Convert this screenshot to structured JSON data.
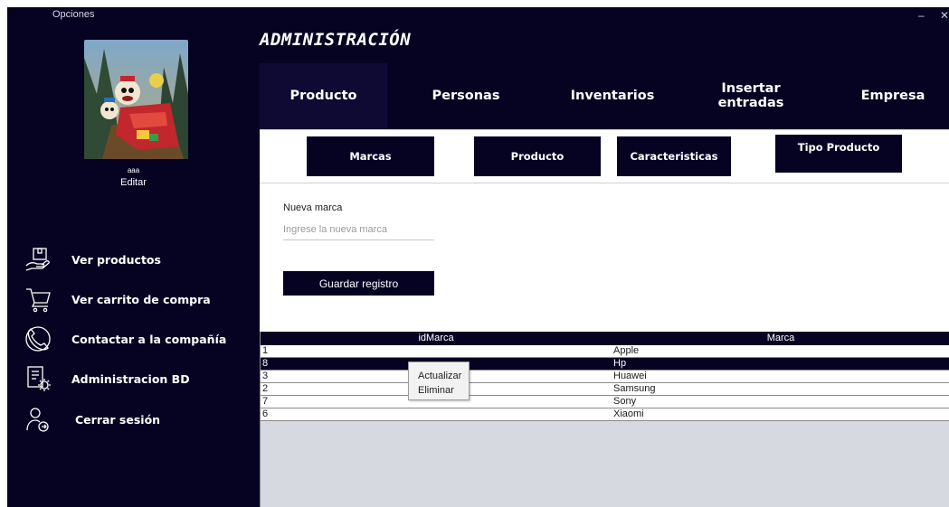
{
  "window": {
    "menu_label": "Opciones",
    "minimize_label": "–",
    "close_label": "✕"
  },
  "user": {
    "name": "aaa",
    "edit_label": "Editar"
  },
  "sidebar": {
    "items": [
      {
        "label": "Ver productos",
        "icon": "box-hand-icon"
      },
      {
        "label": "Ver carrito de compra",
        "icon": "shopping-cart-icon"
      },
      {
        "label": "Contactar a la compañía",
        "icon": "phone-icon"
      },
      {
        "label": "Administracion BD",
        "icon": "database-gear-icon"
      },
      {
        "label": "Cerrar sesión",
        "icon": "user-logout-icon"
      }
    ]
  },
  "header": {
    "title": "ADMINISTRACIÓN"
  },
  "main_tabs": [
    {
      "label": "Producto"
    },
    {
      "label": "Personas"
    },
    {
      "label": "Inventarios"
    },
    {
      "label": "Insertar entradas"
    },
    {
      "label": "Empresa"
    }
  ],
  "sub_tabs": [
    {
      "label": "Marcas"
    },
    {
      "label": "Producto"
    },
    {
      "label": "Caracteristicas"
    },
    {
      "label": "Tipo Producto"
    }
  ],
  "form": {
    "label": "Nueva marca",
    "placeholder": "Ingrese la nueva marca",
    "save_label": "Guardar registro"
  },
  "table": {
    "columns": [
      "idMarca",
      "Marca"
    ],
    "rows": [
      {
        "id": "1",
        "marca": "Apple"
      },
      {
        "id": "8",
        "marca": "Hp"
      },
      {
        "id": "3",
        "marca": "Huawei"
      },
      {
        "id": "2",
        "marca": "Samsung"
      },
      {
        "id": "7",
        "marca": "Sony"
      },
      {
        "id": "6",
        "marca": "Xiaomi"
      }
    ]
  },
  "context_menu": {
    "items": [
      {
        "label": "Actualizar"
      },
      {
        "label": "Eliminar"
      }
    ]
  },
  "colors": {
    "dark_navy": "#060322",
    "active_tab": "#0e0a33",
    "table_bg": "#d6d9df"
  }
}
